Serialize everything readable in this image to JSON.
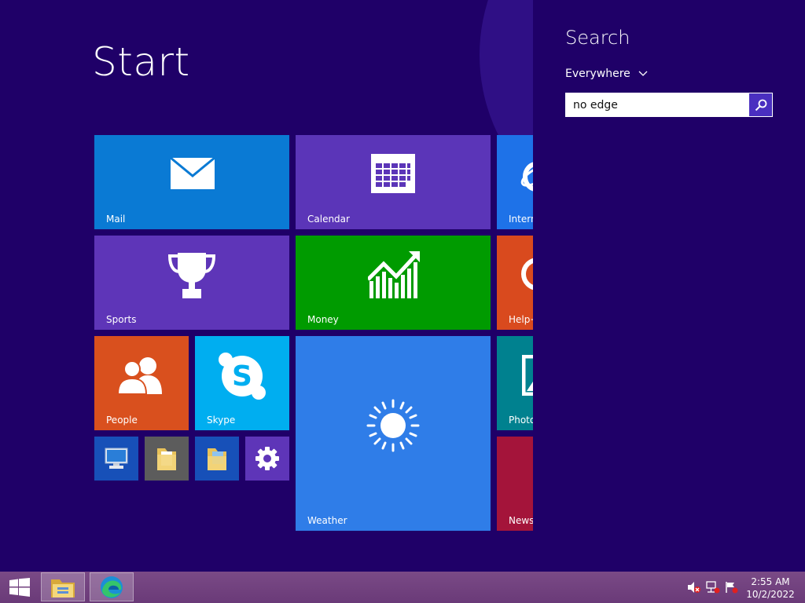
{
  "start": {
    "title": "Start",
    "tiles": {
      "mail": {
        "label": "Mail",
        "color": "#0a7ad4",
        "icon": "mail-icon"
      },
      "calendar": {
        "label": "Calendar",
        "color": "#5b35b8",
        "icon": "calendar-icon"
      },
      "internet_explorer": {
        "label": "Intern",
        "color": "#1e72e8",
        "icon": "internet-explorer-icon"
      },
      "sports": {
        "label": "Sports",
        "color": "#5e35b8",
        "icon": "trophy-icon"
      },
      "money": {
        "label": "Money",
        "color": "#009b00",
        "icon": "chart-icon"
      },
      "help": {
        "label": "Help+",
        "color": "#d94a1e",
        "icon": "help-icon"
      },
      "people": {
        "label": "People",
        "color": "#d9501e",
        "icon": "people-icon"
      },
      "skype": {
        "label": "Skype",
        "color": "#00aef0",
        "icon": "skype-icon"
      },
      "weather": {
        "label": "Weather",
        "color": "#2f7de8",
        "icon": "sun-icon"
      },
      "photos": {
        "label": "Photo",
        "color": "#00818f",
        "icon": "photo-icon"
      },
      "news": {
        "label": "News",
        "color": "#a4143a",
        "icon": "news-icon"
      },
      "computer": {
        "color": "#1750b8",
        "icon": "computer-icon"
      },
      "documents": {
        "color": "#5c5c5c",
        "icon": "documents-folder-icon"
      },
      "pictures": {
        "color": "#1750b8",
        "icon": "pictures-folder-icon"
      },
      "settings": {
        "color": "#5e35b8",
        "icon": "gear-icon"
      }
    }
  },
  "search": {
    "title": "Search",
    "scope": "Everywhere",
    "query": "no edge",
    "button_icon": "search-icon"
  },
  "taskbar": {
    "items": [
      {
        "name": "file-explorer",
        "icon": "file-explorer-icon"
      },
      {
        "name": "microsoft-edge",
        "icon": "edge-icon"
      }
    ],
    "tray": [
      "speaker-muted-icon",
      "network-icon",
      "action-center-icon"
    ],
    "time": "2:55 AM",
    "date": "10/2/2022"
  },
  "colors": {
    "background": "#1f0068",
    "taskbar": "#6f3f7d",
    "search_button": "#4a2fc0"
  }
}
